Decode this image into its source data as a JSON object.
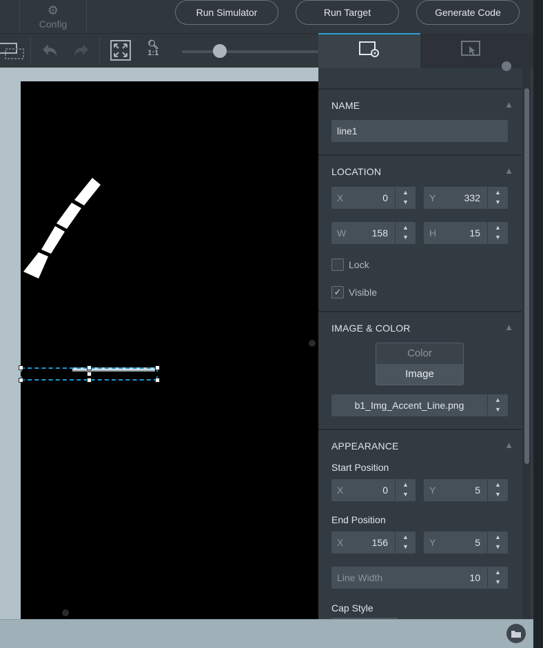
{
  "topbar": {
    "config_label": "Config",
    "run_simulator": "Run Simulator",
    "run_target": "Run Target",
    "generate_code": "Generate Code"
  },
  "toolbar": {
    "zoom_label": "1:1",
    "zoom_level_fraction": 0.28
  },
  "panel": {
    "name_section": {
      "title": "NAME",
      "value": "line1"
    },
    "location_section": {
      "title": "LOCATION",
      "x_prefix": "X",
      "x": "0",
      "y_prefix": "Y",
      "y": "332",
      "w_prefix": "W",
      "w": "158",
      "h_prefix": "H",
      "h": "15",
      "lock_label": "Lock",
      "lock_checked": false,
      "visible_label": "Visible",
      "visible_checked": true,
      "visible_check_glyph": "✓"
    },
    "image_color_section": {
      "title": "IMAGE & COLOR",
      "color_option": "Color",
      "image_option": "Image",
      "selected_option": "Image",
      "image_file": "b1_Img_Accent_Line.png"
    },
    "appearance_section": {
      "title": "APPEARANCE",
      "start_label": "Start Position",
      "start_x_prefix": "X",
      "start_x": "0",
      "start_y_prefix": "Y",
      "start_y": "5",
      "end_label": "End Position",
      "end_x_prefix": "X",
      "end_x": "156",
      "end_y_prefix": "Y",
      "end_y": "5",
      "line_width_label": "Line Width",
      "line_width": "10",
      "cap_style_label": "Cap Style"
    }
  },
  "colors": {
    "accent": "#2a9fd8",
    "canvas_bg": "#000000",
    "workspace_bg": "#b3c2c9",
    "panel_bg": "#333b42"
  }
}
